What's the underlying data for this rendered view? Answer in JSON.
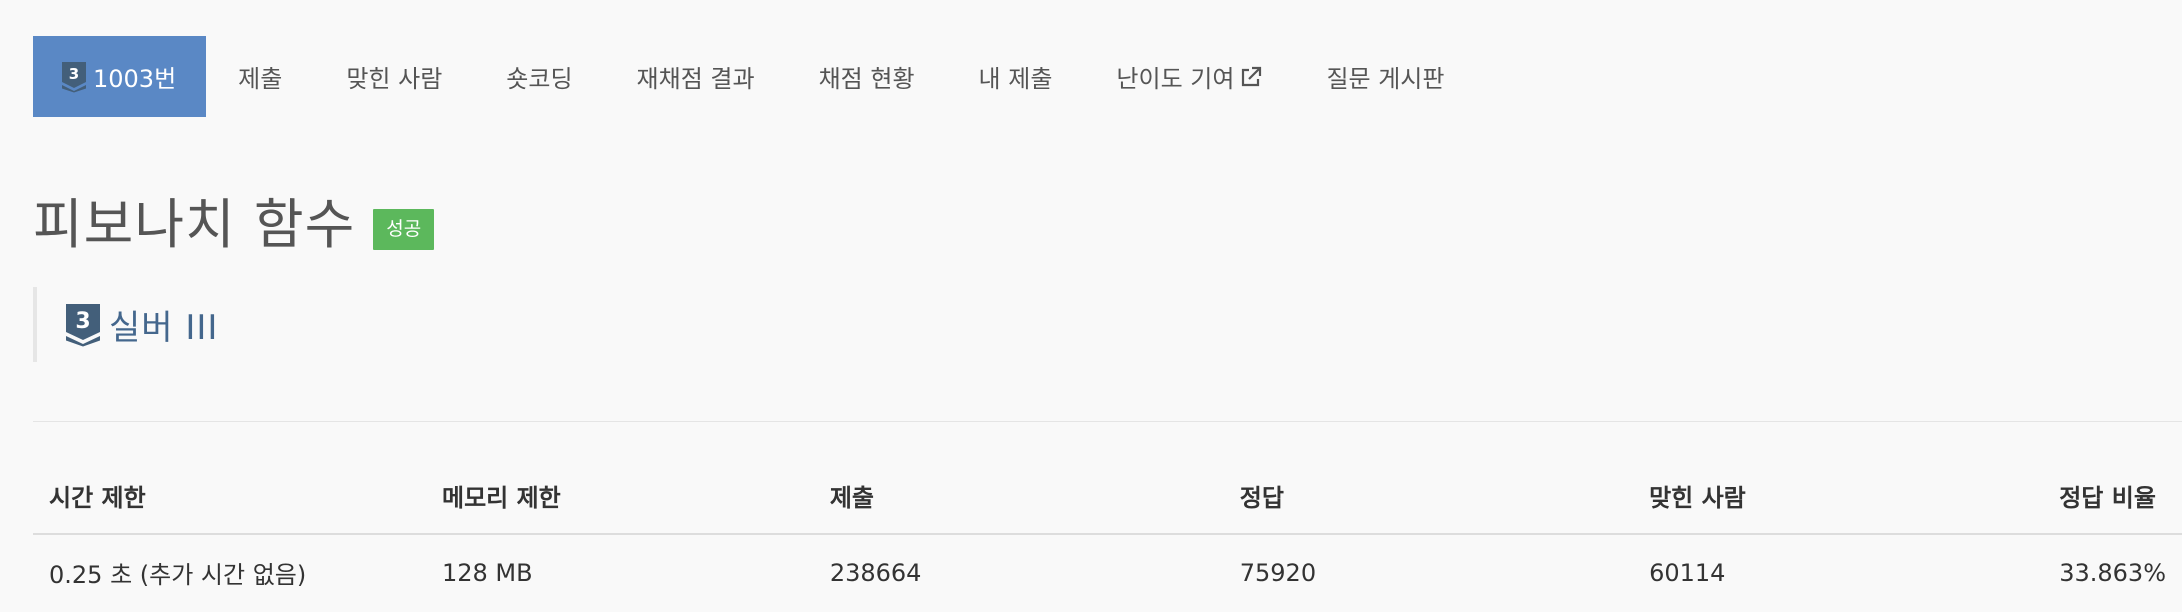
{
  "colors": {
    "active_tab": "#5a88c5",
    "success_badge": "#5cb85c",
    "tier_silver": "#435f7a"
  },
  "nav": {
    "problem_tier_level": "3",
    "problem_tier_icon": "silver-tier-shield-icon",
    "items": [
      {
        "label": "1003번",
        "active": true
      },
      {
        "label": "제출"
      },
      {
        "label": "맞힌 사람"
      },
      {
        "label": "숏코딩"
      },
      {
        "label": "재채점 결과"
      },
      {
        "label": "채점 현황"
      },
      {
        "label": "내 제출"
      },
      {
        "label": "난이도 기여",
        "icon": "external-link-icon"
      },
      {
        "label": "질문 게시판"
      }
    ]
  },
  "problem": {
    "title": "피보나치 함수",
    "status": "성공",
    "tier_level": "3",
    "tier_name": "실버 III"
  },
  "info_table": {
    "headers": [
      "시간 제한",
      "메모리 제한",
      "제출",
      "정답",
      "맞힌 사람",
      "정답 비율"
    ],
    "rows": [
      [
        "0.25 초 (추가 시간 없음)",
        "128 MB",
        "238664",
        "75920",
        "60114",
        "33.863%"
      ]
    ]
  }
}
